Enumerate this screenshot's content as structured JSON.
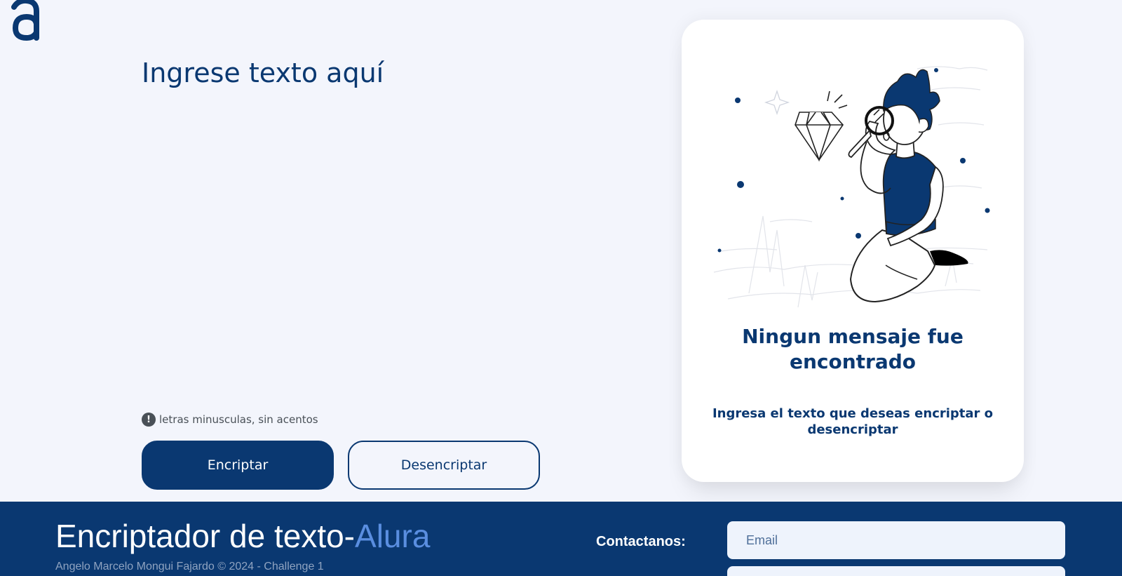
{
  "logo": {
    "icon": "alura-logo-icon",
    "color": "#0a3871"
  },
  "input": {
    "placeholder": "Ingrese texto aquí",
    "value": ""
  },
  "hint": {
    "icon": "exclamation-circle-icon",
    "text": "letras minusculas, sin acentos"
  },
  "buttons": {
    "encrypt": "Encriptar",
    "decrypt": "Desencriptar"
  },
  "result_card": {
    "illustration": "person-with-magnifying-glass-illustration",
    "title": "Ningun mensaje fue encontrado",
    "subtitle": "Ingresa el texto que deseas encriptar o desencriptar"
  },
  "footer": {
    "title_main": "Encriptador de texto-",
    "title_accent": "Alura",
    "credit": "Angelo Marcelo Mongui Fajardo © 2024 - Challenge 1",
    "contact_label": "Contactanos:",
    "email_placeholder": "Email"
  },
  "colors": {
    "primary": "#0a3871",
    "background": "#f3f5fc",
    "accent": "#5a8ee0",
    "card": "#ffffff"
  }
}
